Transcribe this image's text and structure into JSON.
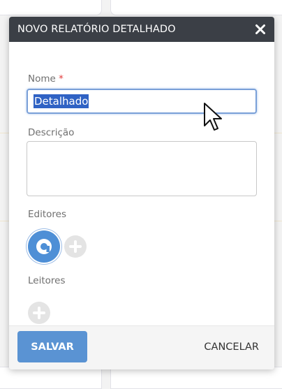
{
  "modal": {
    "title": "NOVO RELATÓRIO DETALHADO",
    "close_icon": "close-icon"
  },
  "form": {
    "name_label": "Nome",
    "required_mark": "*",
    "name_value": "Detalhado",
    "description_label": "Descrição",
    "description_value": "",
    "editors_label": "Editores",
    "readers_label": "Leitores",
    "editor_avatar_icon": "user-avatar-icon",
    "add_icon": "plus-icon"
  },
  "footer": {
    "save_label": "SALVAR",
    "cancel_label": "CANCELAR"
  },
  "colors": {
    "header_bg": "#3b3f46",
    "primary": "#5a93d3",
    "selection": "#2f62c4",
    "required": "#e23b3b"
  }
}
